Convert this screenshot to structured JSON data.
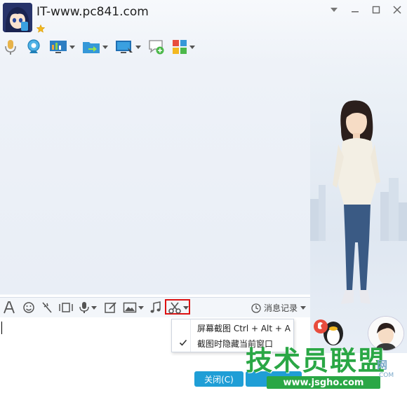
{
  "window": {
    "title": "IT-www.pc841.com",
    "controls": [
      "chevron-down-icon",
      "minimize-icon",
      "maximize-icon",
      "close-icon"
    ]
  },
  "app_toolbar": {
    "items": [
      "microphone-icon",
      "webcam-icon",
      "remote-desktop-icon",
      "file-transfer-icon",
      "screen-share-icon",
      "chat-add-icon",
      "apps-icon"
    ]
  },
  "input_toolbar": {
    "items": [
      "font-icon",
      "emoji-icon",
      "nudge-icon",
      "video-icon",
      "voice-icon",
      "edit-icon",
      "image-icon",
      "music-icon",
      "scissors-icon"
    ],
    "history_label": "消息记录"
  },
  "screenshot_menu": {
    "items": [
      {
        "label": "屏幕截图 Ctrl + Alt + A",
        "checked": false
      },
      {
        "label": "截图时隐藏当前窗口",
        "checked": true
      }
    ]
  },
  "buttons": {
    "close_label": "关闭(C)"
  },
  "watermark": {
    "main": "技术员联盟",
    "url": "www.jsgho.com",
    "suffix": "网",
    "suffix2": "COM"
  },
  "colors": {
    "accent": "#1f9ed6",
    "highlight": "#d11111",
    "watermark": "#2aa745"
  }
}
